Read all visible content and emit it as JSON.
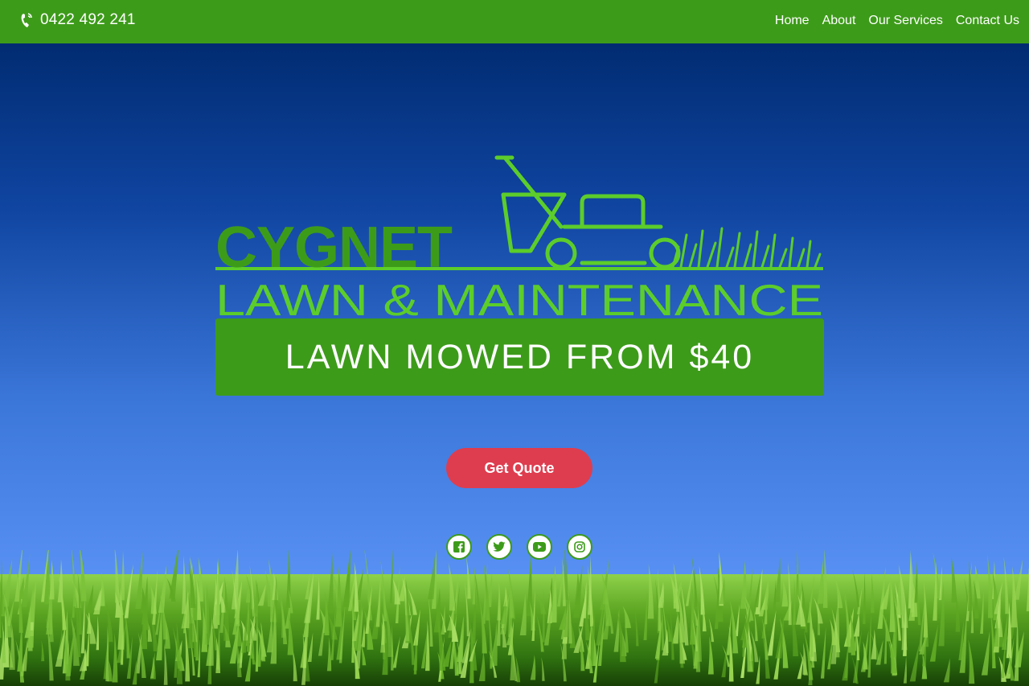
{
  "header": {
    "phone": "0422 492 241",
    "nav": [
      "Home",
      "About",
      "Our Services",
      "Contact Us"
    ]
  },
  "logo": {
    "line1": "CYGNET",
    "line2": "LAWN & MAINTENANCE"
  },
  "hero": {
    "banner": "LAWN MOWED FROM $40",
    "cta": "Get Quote"
  },
  "social": [
    "facebook-icon",
    "twitter-icon",
    "youtube-icon",
    "instagram-icon"
  ],
  "colors": {
    "brand_green": "#3d9b1a",
    "logo_green": "#5ccd2a",
    "cta_red": "#de3d4f",
    "sky_top": "#012c72",
    "sky_bottom": "#5c95f7"
  }
}
